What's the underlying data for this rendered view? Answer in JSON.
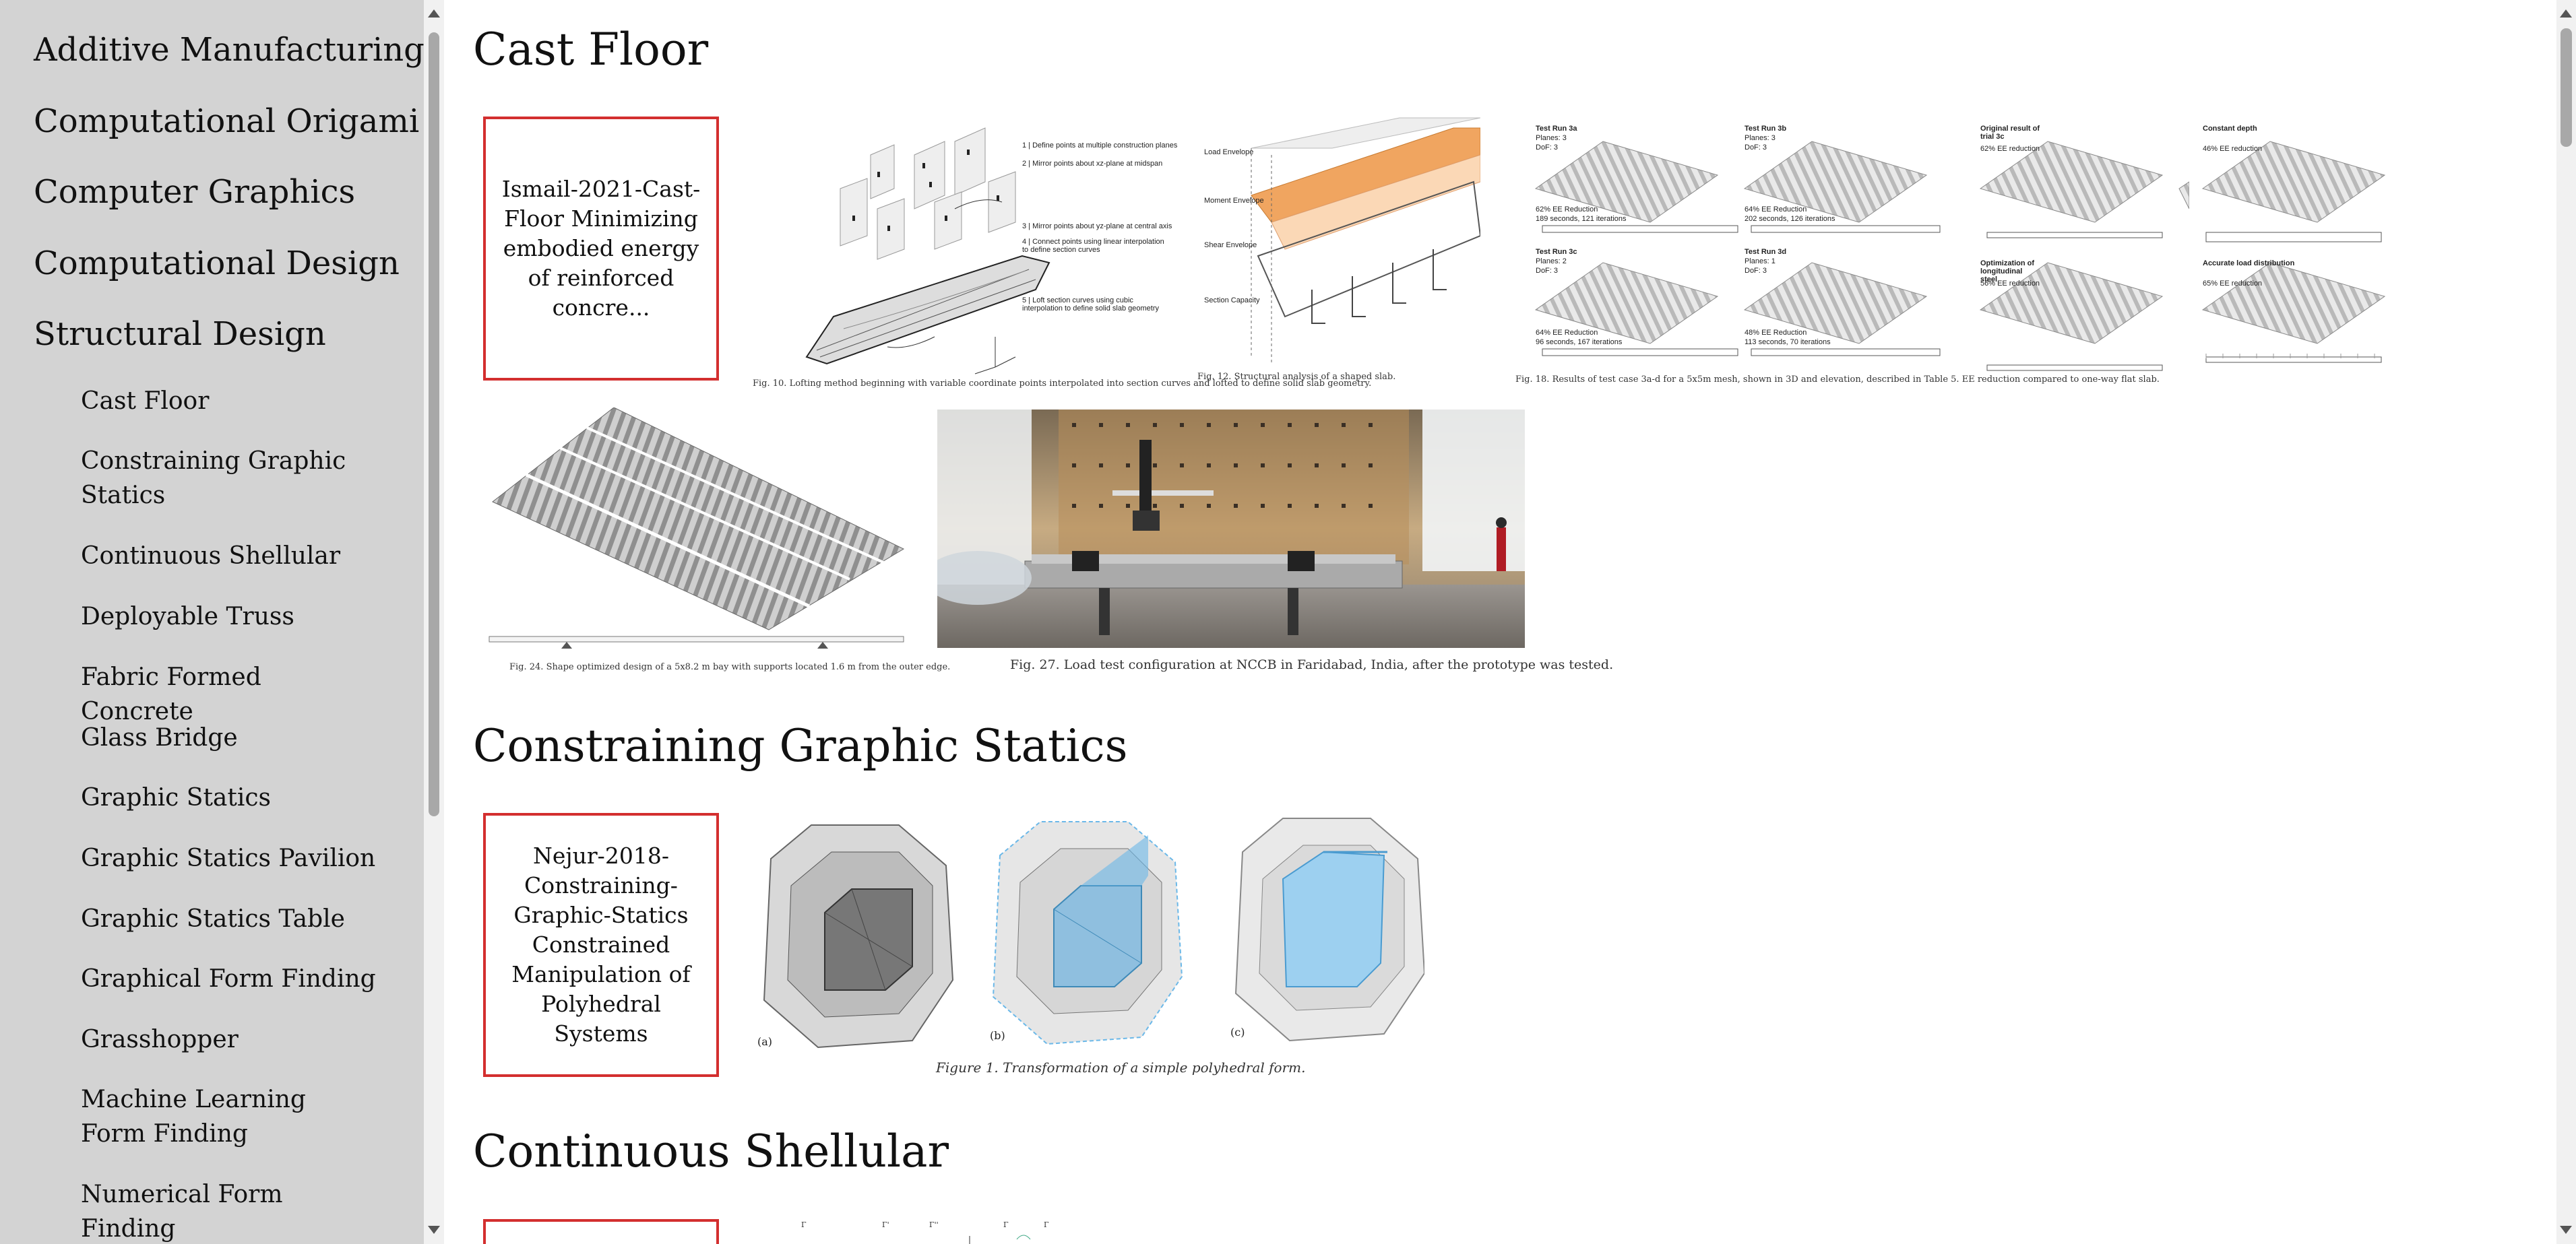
{
  "sidebar": {
    "top_items": [
      {
        "label": "Additive Manufacturing"
      },
      {
        "label": "Computational Origami"
      },
      {
        "label": "Computer Graphics"
      },
      {
        "label": "Computational Design"
      },
      {
        "label": "Structural Design"
      }
    ],
    "sub_items": [
      {
        "label": "Cast Floor"
      },
      {
        "label": "Constraining Graphic Statics"
      },
      {
        "label": "Continuous Shellular"
      },
      {
        "label": "Deployable Truss"
      },
      {
        "label": "Fabric Formed Concrete"
      },
      {
        "label": "Glass Bridge"
      },
      {
        "label": "Graphic Statics"
      },
      {
        "label": "Graphic Statics Pavilion"
      },
      {
        "label": "Graphic Statics Table"
      },
      {
        "label": "Graphical Form Finding"
      },
      {
        "label": "Grasshopper"
      },
      {
        "label": "Machine Learning Form Finding"
      },
      {
        "label": "Numerical Form Finding"
      }
    ]
  },
  "sections": [
    {
      "title": "Cast Floor",
      "paper": "Ismail-2021-Cast-Floor Minimizing embodied energy of reinforced concre...",
      "captions": {
        "fig10": "Fig. 10. Lofting method beginning with variable coordinate points interpolated into section curves and lofted to define solid slab geometry.",
        "fig12": "Fig. 12. Structural analysis of a shaped slab.",
        "fig18": "Fig. 18. Results of test case 3a-d for a 5x5m mesh, shown in 3D and elevation, described in Table 5. EE reduction compared to one-way flat slab.",
        "fig24": "Fig. 24. Shape optimized design of a 5x8.2 m bay with supports located 1.6 m from the outer edge.",
        "fig27": "Fig. 27. Load test configuration at NCCB in Faridabad, India, after the prototype was tested."
      },
      "fig10_labels": [
        "1 | Define points at multiple construction planes",
        "2 | Mirror points about xz-plane at midspan",
        "3 | Mirror points about yz-plane at central axis",
        "4 | Connect points using linear interpolation to define section curves",
        "5 | Loft section curves using cubic interpolation to define solid slab geometry"
      ],
      "fig12_labels": [
        "Load Envelope",
        "Moment Envelope",
        "Shear Envelope",
        "Section Capacity"
      ],
      "fig18_labels": [
        {
          "title": "Test Run 3a",
          "l1": "Planes: 3",
          "l2": "DoF: 3",
          "r1": "62% EE Reduction",
          "r2": "189 seconds, 121 iterations"
        },
        {
          "title": "Test Run 3b",
          "l1": "Planes: 3",
          "l2": "DoF: 3",
          "r1": "64% EE Reduction",
          "r2": "202 seconds, 126 iterations"
        },
        {
          "title": "Test Run 3c",
          "l1": "Planes: 2",
          "l2": "DoF: 3",
          "r1": "64% EE Reduction",
          "r2": "96 seconds, 167 iterations"
        },
        {
          "title": "Test Run 3d",
          "l1": "Planes: 1",
          "l2": "DoF: 3",
          "r1": "48% EE Reduction",
          "r2": "113 seconds, 70 iterations"
        }
      ],
      "fig18b_labels": [
        {
          "title": "Original result of trial 3c",
          "r1": "62% EE reduction"
        },
        {
          "title": "Constant depth",
          "r1": "46% EE reduction"
        },
        {
          "title": "Optimization of longitudinal steel",
          "r1": "56% EE reduction"
        },
        {
          "title": "Accurate load distribution",
          "r1": "65% EE reduction"
        }
      ]
    },
    {
      "title": "Constraining Graphic Statics",
      "paper": "Nejur-2018-Constraining-Graphic-Statics Constrained Manipulation of Polyhedral Systems",
      "caption": "Figure 1. Transformation of a simple polyhedral form.",
      "sub_labels": [
        "(a)",
        "(b)",
        "(c)"
      ]
    },
    {
      "title": "Continuous Shellular",
      "paper": ""
    }
  ],
  "colors": {
    "sidebar_bg": "#d3d3d3",
    "card_border": "#d32f2f",
    "accent_orange": "#f0a560",
    "accent_blue": "#6bb8e8"
  }
}
